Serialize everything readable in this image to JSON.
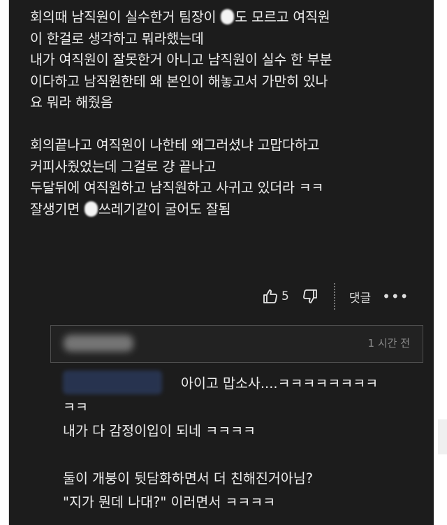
{
  "comment": {
    "line1_pre": "회의때 남직원이 실수한거 팀장이 ",
    "line1_post": "도 모르고 여직원",
    "rest_lines": "이 한걸로 생각하고 뭐라했는데\n내가 여직원이 잘못한거 아니고 남직원이 실수 한 부분\n이다하고 남직원한테 왜 본인이 해놓고서 가만히 있나\n요 뭐라 해줬음\n\n회의끝나고 여직원이 나한테 왜그러셨냐 고맙다하고\n커피사줬었는데 그걸로 걍 끝나고\n두달뒤에 여직원하고 남직원하고 사귀고 있더라 ㅋㅋ",
    "last_pre": "잘생기면 ",
    "last_post": "쓰레기같이 굴어도 잘됨"
  },
  "actions": {
    "like_count": "5",
    "reply_label": "댓글",
    "more_label": "•••",
    "like_icon": "thumbs-up-icon",
    "dislike_icon": "thumbs-down-icon"
  },
  "reply1": {
    "time": "1 시간 전"
  },
  "reply2": {
    "first_line": "아이고 맙소사....ㅋㅋㅋㅋㅋㅋㅋㅋ",
    "text": "ㅋㅋ\n내가 다 감정이입이 되네 ㅋㅋㅋㅋ\n\n둘이 개붕이 뒷담화하면서 더 친해진거아님?\n\"지가 뭔데 나대?\" 이러면서 ㅋㅋㅋㅋ"
  }
}
